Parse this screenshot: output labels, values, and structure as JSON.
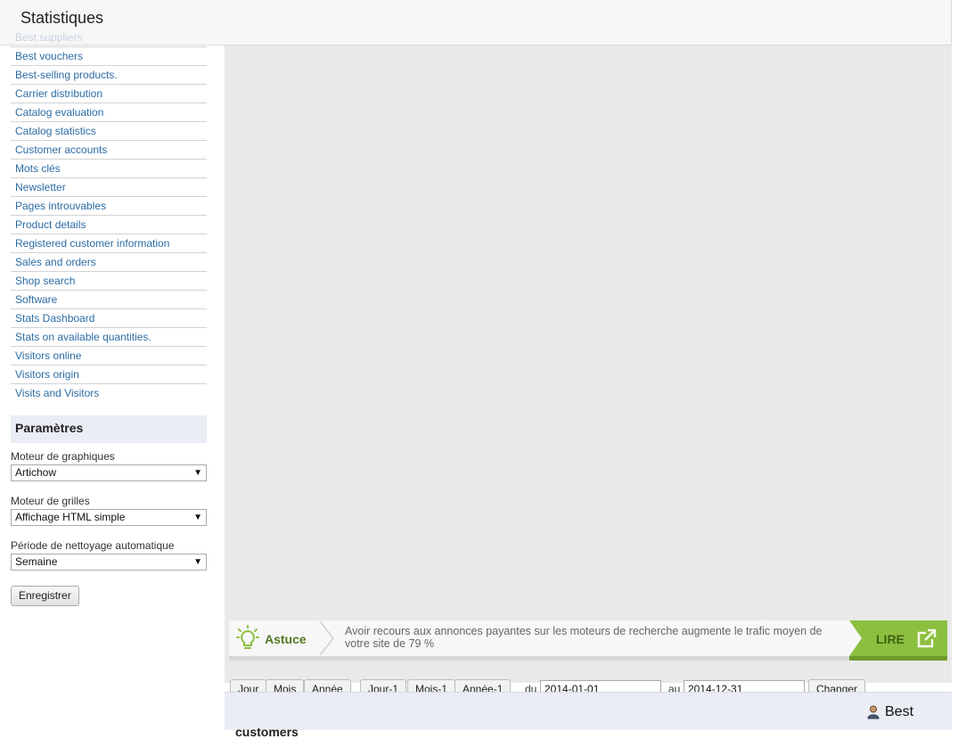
{
  "header": {
    "title": "Statistiques"
  },
  "sidebar": {
    "faded_item": "Best suppliers",
    "items": [
      "Best vouchers",
      "Best-selling products.",
      "Carrier distribution",
      "Catalog evaluation",
      "Catalog statistics",
      "Customer accounts",
      "Mots clés",
      "Newsletter",
      "Pages introuvables",
      "Product details",
      "Registered customer information",
      "Sales and orders",
      "Shop search",
      "Software",
      "Stats Dashboard",
      "Stats on available quantities.",
      "Visitors online",
      "Visitors origin",
      "Visits and Visitors"
    ]
  },
  "params": {
    "title": "Paramètres",
    "graph_engine_label": "Moteur de graphiques",
    "graph_engine_value": "Artichow",
    "grid_engine_label": "Moteur de grilles",
    "grid_engine_value": "Affichage HTML simple",
    "cleanup_label": "Période de nettoyage automatique",
    "cleanup_value": "Semaine",
    "save_label": "Enregistrer"
  },
  "tip": {
    "label": "Astuce",
    "text": "Avoir recours aux annonces payantes sur les moteurs de recherche augmente le trafic moyen de votre site de 79 %",
    "read_label": "LIRE"
  },
  "period": {
    "day": "Jour",
    "month": "Mois",
    "year": "Année",
    "prev_day": "Jour-1",
    "prev_month": "Mois-1",
    "prev_year": "Année-1",
    "from_label": "du",
    "from_value": "2014-01-01",
    "to_label": "au",
    "to_value": "2014-12-31",
    "change_label": "Changer"
  },
  "results": {
    "title_part1": "Best",
    "title_part2": "customers"
  },
  "colors": {
    "link": "#2c6ca4",
    "tip_green": "#8cbf3f",
    "panel": "#eaedf4"
  }
}
